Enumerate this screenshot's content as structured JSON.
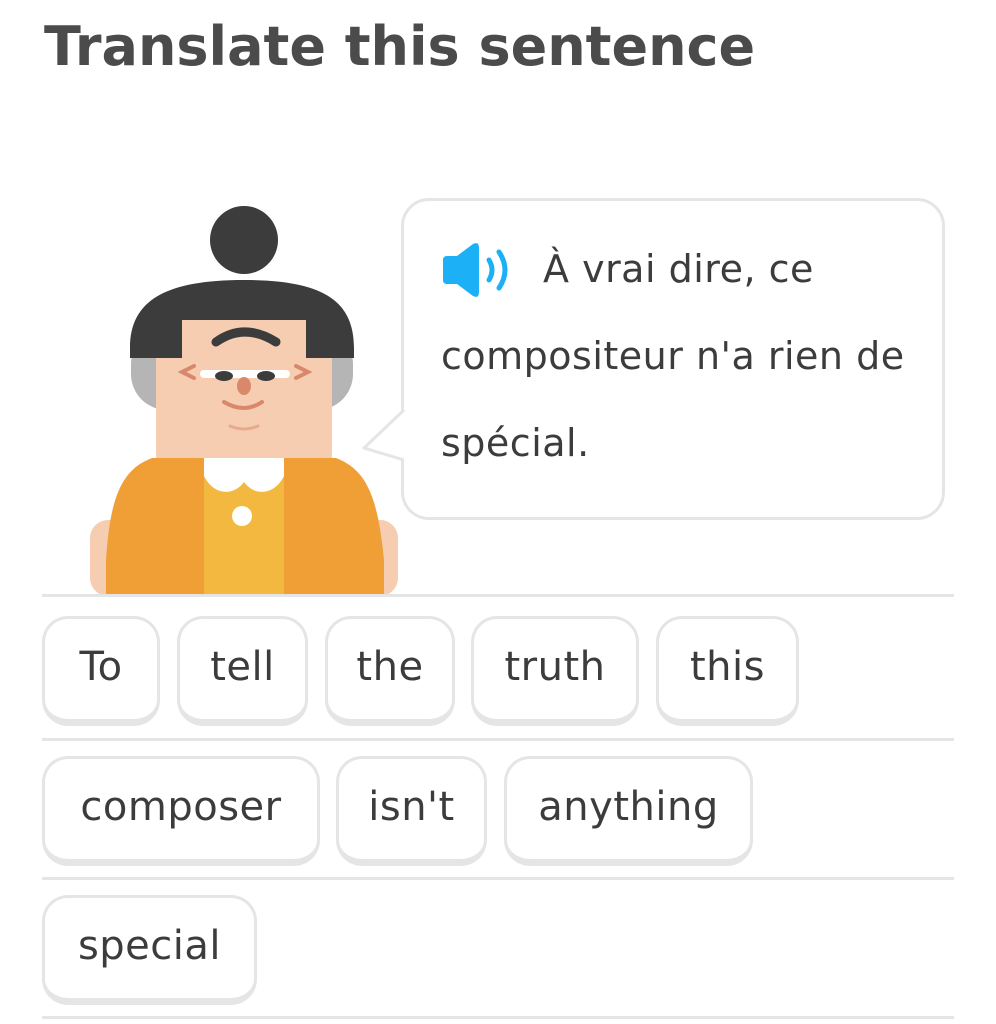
{
  "prompt": {
    "title": "Translate this sentence"
  },
  "speech_bubble": {
    "speaker_icon": "speaker-icon",
    "sentence": "À vrai dire, ce compositeur n'a rien de spécial."
  },
  "word_bank": {
    "tiles": [
      "To",
      "tell",
      "the",
      "truth",
      "this",
      "composer",
      "isn't",
      "anything",
      "special"
    ]
  },
  "colors": {
    "title_text": "#4b4b4b",
    "tile_border": "#e5e5e5",
    "speaker_blue": "#1cb0f6",
    "outfit_orange": "#f09f36",
    "outfit_yellow": "#f2b83f"
  }
}
